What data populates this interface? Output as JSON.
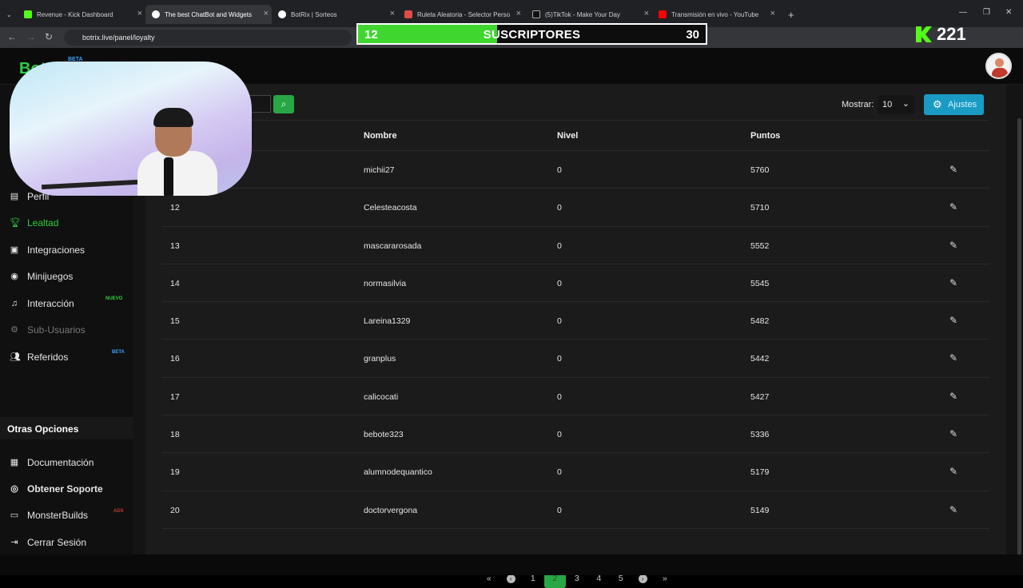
{
  "browser": {
    "tabs": [
      {
        "label": "Revenue - Kick Dashboard",
        "color": "#53fc18"
      },
      {
        "label": "The best ChatBot and Widgets",
        "color": "#ffffff",
        "active": true
      },
      {
        "label": "BotRix | Sorteos",
        "color": "#ffffff"
      },
      {
        "label": "Ruleta Aleatoria - Selector Perso",
        "color": "#e24a4a"
      },
      {
        "label": "(5)TikTok - Make Your Day",
        "color": "#ffffff"
      },
      {
        "label": "Transmisión en vivo - YouTube",
        "color": "#ff0000"
      }
    ],
    "url": "botrix.live/panel/loyalty"
  },
  "overlay": {
    "sub_current": "12",
    "sub_label": "SUSCRIPTORES",
    "sub_goal": "30",
    "sub_progress": 0.4,
    "kick_count": "221"
  },
  "app": {
    "logo": "Bot",
    "logo_badge": "BETA"
  },
  "sidebar": {
    "items": [
      {
        "label": "Perfil",
        "icon": "id-card-icon"
      },
      {
        "label": "Lealtad",
        "icon": "trophy-icon",
        "active": true
      },
      {
        "label": "Integraciones",
        "icon": "window-icon"
      },
      {
        "label": "Minijuegos",
        "icon": "gamepad-icon"
      },
      {
        "label": "Interacción",
        "icon": "music-icon",
        "badge": "NUEVO"
      },
      {
        "label": "Sub-Usuarios",
        "icon": "users-cog-icon",
        "disabled": true
      },
      {
        "label": "Referidos",
        "icon": "users-icon",
        "badge": "BETA"
      }
    ],
    "section_title": "Otras Opciones",
    "other_items": [
      {
        "label": "Documentación",
        "icon": "book-icon"
      },
      {
        "label": "Obtener Soporte",
        "icon": "support-icon"
      },
      {
        "label": "MonsterBuilds",
        "icon": "desktop-icon",
        "badge": "ADS"
      },
      {
        "label": "Cerrar Sesión",
        "icon": "sign-out-icon"
      }
    ]
  },
  "toolbar": {
    "mostrar_label": "Mostrar:",
    "mostrar_value": "10",
    "ajustes_label": "Ajustes"
  },
  "table": {
    "headers": [
      "Nombre",
      "Nivel",
      "Puntos"
    ],
    "rows": [
      {
        "rank": "",
        "name": "michii27",
        "level": "0",
        "points": "5760"
      },
      {
        "rank": "12",
        "name": "Celesteacosta",
        "level": "0",
        "points": "5710"
      },
      {
        "rank": "13",
        "name": "mascararosada",
        "level": "0",
        "points": "5552"
      },
      {
        "rank": "14",
        "name": "normasilvia",
        "level": "0",
        "points": "5545"
      },
      {
        "rank": "15",
        "name": "Lareina1329",
        "level": "0",
        "points": "5482"
      },
      {
        "rank": "16",
        "name": "granplus",
        "level": "0",
        "points": "5442"
      },
      {
        "rank": "17",
        "name": "calicocati",
        "level": "0",
        "points": "5427"
      },
      {
        "rank": "18",
        "name": "bebote323",
        "level": "0",
        "points": "5336"
      },
      {
        "rank": "19",
        "name": "alumnodequantico",
        "level": "0",
        "points": "5179"
      },
      {
        "rank": "20",
        "name": "doctorvergona",
        "level": "0",
        "points": "5149"
      }
    ]
  },
  "pagination": {
    "pages": [
      "1",
      "2",
      "3",
      "4",
      "5"
    ],
    "active": "2"
  }
}
